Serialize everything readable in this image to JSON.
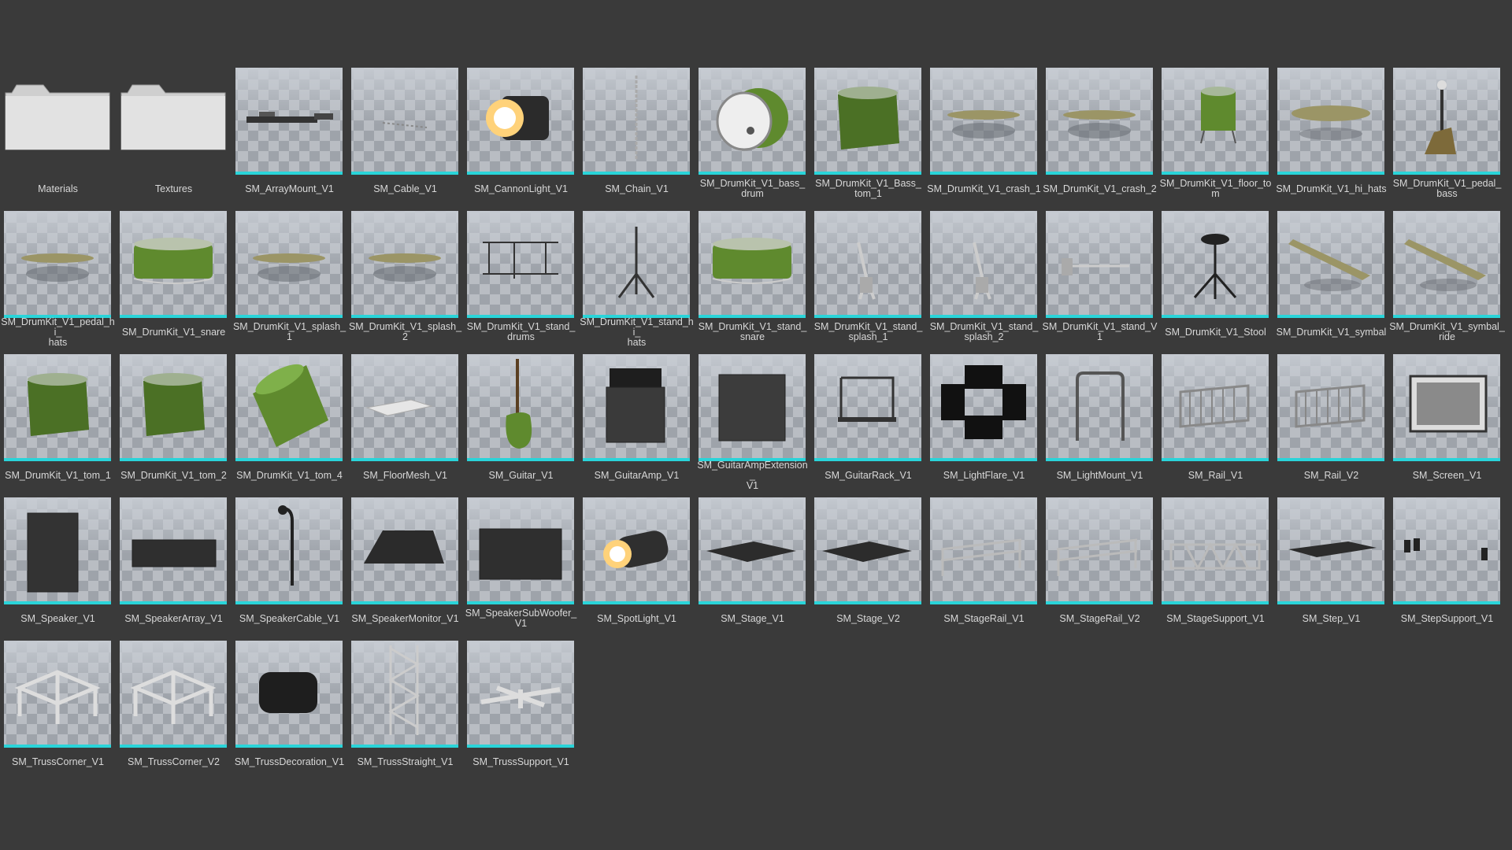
{
  "browser": {
    "items": [
      {
        "label": "Materials",
        "kind": "folder",
        "icon": "folder-icon"
      },
      {
        "label": "Textures",
        "kind": "folder",
        "icon": "folder-icon"
      },
      {
        "label": "SM_ArrayMount_V1",
        "kind": "mesh",
        "icon": "array-mount-icon"
      },
      {
        "label": "SM_Cable_V1",
        "kind": "mesh",
        "icon": "cable-icon"
      },
      {
        "label": "SM_CannonLight_V1",
        "kind": "mesh",
        "icon": "cannon-light-icon"
      },
      {
        "label": "SM_Chain_V1",
        "kind": "mesh",
        "icon": "chain-icon"
      },
      {
        "label": "SM_DrumKit_V1_bass_\ndrum",
        "kind": "mesh",
        "icon": "bass-drum-icon"
      },
      {
        "label": "SM_DrumKit_V1_Bass_\ntom_1",
        "kind": "mesh",
        "icon": "tom-icon"
      },
      {
        "label": "SM_DrumKit_V1_crash_1",
        "kind": "mesh",
        "icon": "cymbal-icon"
      },
      {
        "label": "SM_DrumKit_V1_crash_2",
        "kind": "mesh",
        "icon": "cymbal-icon"
      },
      {
        "label": "SM_DrumKit_V1_floor_tom",
        "kind": "mesh",
        "icon": "floor-tom-icon"
      },
      {
        "label": "SM_DrumKit_V1_hi_hats",
        "kind": "mesh",
        "icon": "hi-hats-icon"
      },
      {
        "label": "SM_DrumKit_V1_pedal_\nbass",
        "kind": "mesh",
        "icon": "pedal-icon"
      },
      {
        "label": "SM_DrumKit_V1_pedal_hi_\nhats",
        "kind": "mesh",
        "icon": "cymbal-icon"
      },
      {
        "label": "SM_DrumKit_V1_snare",
        "kind": "mesh",
        "icon": "snare-icon"
      },
      {
        "label": "SM_DrumKit_V1_splash_1",
        "kind": "mesh",
        "icon": "cymbal-icon"
      },
      {
        "label": "SM_DrumKit_V1_splash_2",
        "kind": "mesh",
        "icon": "cymbal-icon"
      },
      {
        "label": "SM_DrumKit_V1_stand_\ndrums",
        "kind": "mesh",
        "icon": "drum-stand-icon"
      },
      {
        "label": "SM_DrumKit_V1_stand_hi_\nhats",
        "kind": "mesh",
        "icon": "tripod-stand-icon"
      },
      {
        "label": "SM_DrumKit_V1_stand_\nsnare",
        "kind": "mesh",
        "icon": "snare-icon"
      },
      {
        "label": "SM_DrumKit_V1_stand_\nsplash_1",
        "kind": "mesh",
        "icon": "boom-stand-icon"
      },
      {
        "label": "SM_DrumKit_V1_stand_\nsplash_2",
        "kind": "mesh",
        "icon": "boom-stand-icon"
      },
      {
        "label": "SM_DrumKit_V1_stand_V1",
        "kind": "mesh",
        "icon": "boom-arm-icon"
      },
      {
        "label": "SM_DrumKit_V1_Stool",
        "kind": "mesh",
        "icon": "stool-icon"
      },
      {
        "label": "SM_DrumKit_V1_symbal",
        "kind": "mesh",
        "icon": "tilted-cymbal-icon"
      },
      {
        "label": "SM_DrumKit_V1_symbal_\nride",
        "kind": "mesh",
        "icon": "tilted-cymbal-icon"
      },
      {
        "label": "SM_DrumKit_V1_tom_1",
        "kind": "mesh",
        "icon": "tom-icon"
      },
      {
        "label": "SM_DrumKit_V1_tom_2",
        "kind": "mesh",
        "icon": "tom-icon"
      },
      {
        "label": "SM_DrumKit_V1_tom_4",
        "kind": "mesh",
        "icon": "tilted-tom-icon"
      },
      {
        "label": "SM_FloorMesh_V1",
        "kind": "mesh",
        "icon": "floor-plane-icon"
      },
      {
        "label": "SM_Guitar_V1",
        "kind": "mesh",
        "icon": "guitar-icon"
      },
      {
        "label": "SM_GuitarAmp_V1",
        "kind": "mesh",
        "icon": "guitar-amp-icon"
      },
      {
        "label": "SM_GuitarAmpExtension_\nV1",
        "kind": "mesh",
        "icon": "speaker-cabinet-icon"
      },
      {
        "label": "SM_GuitarRack_V1",
        "kind": "mesh",
        "icon": "guitar-rack-icon"
      },
      {
        "label": "SM_LightFlare_V1",
        "kind": "mesh",
        "icon": "barn-doors-icon"
      },
      {
        "label": "SM_LightMount_V1",
        "kind": "mesh",
        "icon": "light-mount-icon"
      },
      {
        "label": "SM_Rail_V1",
        "kind": "mesh",
        "icon": "barrier-rail-icon"
      },
      {
        "label": "SM_Rail_V2",
        "kind": "mesh",
        "icon": "barrier-rail-icon"
      },
      {
        "label": "SM_Screen_V1",
        "kind": "mesh",
        "icon": "screen-icon"
      },
      {
        "label": "SM_Speaker_V1",
        "kind": "mesh",
        "icon": "speaker-tower-icon"
      },
      {
        "label": "SM_SpeakerArray_V1",
        "kind": "mesh",
        "icon": "speaker-array-icon"
      },
      {
        "label": "SM_SpeakerCable_V1",
        "kind": "mesh",
        "icon": "speaker-cable-icon"
      },
      {
        "label": "SM_SpeakerMonitor_V1",
        "kind": "mesh",
        "icon": "speaker-monitor-icon"
      },
      {
        "label": "SM_SpeakerSubWoofer_\nV1",
        "kind": "mesh",
        "icon": "subwoofer-icon"
      },
      {
        "label": "SM_SpotLight_V1",
        "kind": "mesh",
        "icon": "spot-light-icon"
      },
      {
        "label": "SM_Stage_V1",
        "kind": "mesh",
        "icon": "stage-platform-icon"
      },
      {
        "label": "SM_Stage_V2",
        "kind": "mesh",
        "icon": "stage-platform-icon"
      },
      {
        "label": "SM_StageRail_V1",
        "kind": "mesh",
        "icon": "stage-rail-icon"
      },
      {
        "label": "SM_StageRail_V2",
        "kind": "mesh",
        "icon": "stage-rail-icon"
      },
      {
        "label": "SM_StageSupport_V1",
        "kind": "mesh",
        "icon": "stage-support-icon"
      },
      {
        "label": "SM_Step_V1",
        "kind": "mesh",
        "icon": "step-icon"
      },
      {
        "label": "SM_StepSupport_V1",
        "kind": "mesh",
        "icon": "step-support-icon"
      },
      {
        "label": "SM_TrussCorner_V1",
        "kind": "mesh",
        "icon": "truss-corner-icon"
      },
      {
        "label": "SM_TrussCorner_V2",
        "kind": "mesh",
        "icon": "truss-corner-icon"
      },
      {
        "label": "SM_TrussDecoration_V1",
        "kind": "mesh",
        "icon": "truss-decoration-icon"
      },
      {
        "label": "SM_TrussStraight_V1",
        "kind": "mesh",
        "icon": "truss-straight-icon"
      },
      {
        "label": "SM_TrussSupport_V1",
        "kind": "mesh",
        "icon": "truss-support-icon"
      }
    ]
  },
  "colors": {
    "background": "#3a3a3a",
    "accent": "#2ad4d9",
    "label_text": "#d8d8d8",
    "drum_green": "#4a7a2a"
  }
}
